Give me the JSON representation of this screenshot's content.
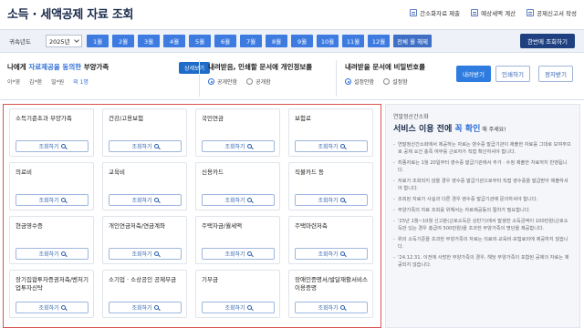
{
  "header": {
    "title": "소득 · 세액공제 자료 조회",
    "links": [
      {
        "label": "간소화자료 제출",
        "icon": "document-icon"
      },
      {
        "label": "예상세액 계산",
        "icon": "calculator-icon"
      },
      {
        "label": "공제신고서 작성",
        "icon": "form-icon"
      }
    ]
  },
  "yearbar": {
    "label": "귀속년도",
    "year": "2025년",
    "months": [
      "1월",
      "2월",
      "3월",
      "4월",
      "5월",
      "6월",
      "7월",
      "8월",
      "9월",
      "10월",
      "11월",
      "12월"
    ],
    "select_all": "전체 월 해제",
    "lookup_all": "한번에 조회하기"
  },
  "options": {
    "consent": {
      "title_pre": "나에게 ",
      "title_hl": "자료제공을 동의한",
      "title_post": " 부양가족",
      "detail": "상세보기",
      "family": [
        "이*영",
        "김*환",
        "밀*원"
      ],
      "count": "외 1명"
    },
    "personal": {
      "title": "내려받음, 인쇄할 문서에 개인정보를",
      "radios": [
        "공개안함",
        "공개함"
      ],
      "selected": 0
    },
    "password": {
      "title": "내려받을 문서에 비밀번호를",
      "radios": [
        "설정안함",
        "설정함"
      ],
      "selected": 0
    },
    "actions": [
      "내려받기",
      "인쇄하기",
      "정자받기"
    ]
  },
  "cards": [
    {
      "name": "소득기준초과 부양가족",
      "button": "조회하기"
    },
    {
      "name": "건강/고용보험",
      "button": "조회하기"
    },
    {
      "name": "국민연금",
      "button": "조회하기"
    },
    {
      "name": "보험료",
      "button": "조회하기"
    },
    {
      "name": "의료비",
      "button": "조회하기"
    },
    {
      "name": "교육비",
      "button": "조회하기"
    },
    {
      "name": "신용카드",
      "button": "조회하기"
    },
    {
      "name": "직불카드 등",
      "button": "조회하기"
    },
    {
      "name": "현금영수증",
      "button": "조회하기"
    },
    {
      "name": "개인연금저축/연금계좌",
      "button": "조회하기"
    },
    {
      "name": "주택자금/월세액",
      "button": "조회하기"
    },
    {
      "name": "주택마련저축",
      "button": "조회하기"
    },
    {
      "name": "장기집합투자증권저축/벤처기업투자신탁",
      "button": "조회하기"
    },
    {
      "name": "소기업 · 소상공인 공제부금",
      "button": "조회하기"
    },
    {
      "name": "기부금",
      "button": "조회하기"
    },
    {
      "name": "장애인증명서/발달재활서비스 이용증명",
      "button": "조회하기"
    }
  ],
  "notice": {
    "pre": "연말정산간소화",
    "head_main": "서비스 이용 전에 ",
    "head_hl": "꼭 확인",
    "head_tail": " 해 주세요!",
    "items": [
      "연말정산간소화에서 제공하는 자료는 영수증 발급기관이 제출한 자료를 그대로 보여주므로 공제 요건 충족 여부를 근로자가 직접 확인하셔야 합니다.",
      "최종자료는 1월 20일부터 영수증 발급기관에서 추가 · 수정 제출한 자료까지 반영됩니다.",
      "자료가 조회되지 않을 경우 영수증 발급기관으로부터 직접 영수증을 발급받아 제출하셔야 합니다.",
      "조회된 자료가 사실과 다른 경우 영수증 발급기관에 문의하셔야 합니다.",
      "부양가족의 자료 조회를 위해서는 자료제공동의 절차가 필요합니다.",
      "'25년 1월~10월 신고분(근로소득은 상반기)에서 발생한 소득금액이 100만원(근로소득만 있는 경우 총급여 500만원)을 초과한 부양가족의 명단을 제공합니다.",
      "위의 소득기준을 초과한 부양가족의 자료는 의료비·교육비·보험료외에 제공하지 않습니다.",
      "'24.12.31. 이전에 사망한 부양가족의 경우, 해당 부양가족이 포함된 공제의 자료는 제공되지 않습니다."
    ]
  },
  "colors": {
    "accent": "#3d7be0",
    "navy": "#1e3f80",
    "highlight_frame": "#d9534f"
  }
}
